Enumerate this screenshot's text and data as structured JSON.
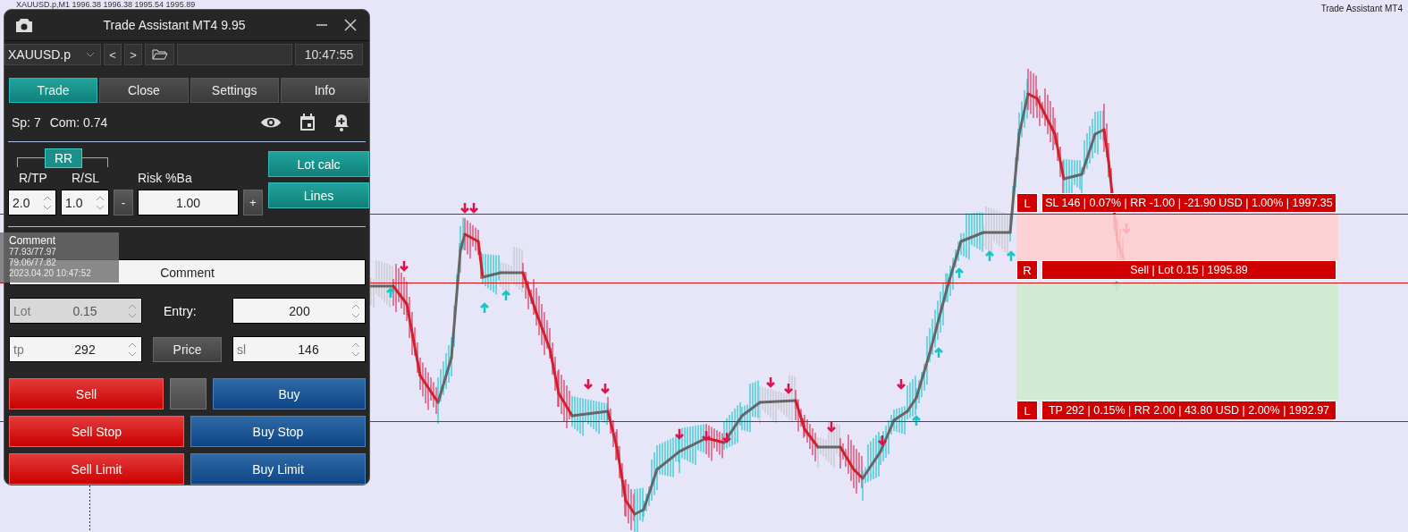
{
  "chart_header": "XAUUSD.p,M1  1996.38 1996.38 1995.54 1995.89",
  "indicator_label": "Trade Assistant MT4",
  "panel": {
    "title": "Trade Assistant MT4 9.95",
    "symbol": "XAUUSD.p",
    "time": "10:47:55",
    "prev": "<",
    "next": ">",
    "tabs": [
      {
        "label": "Trade",
        "selected": true
      },
      {
        "label": "Close",
        "selected": false
      },
      {
        "label": "Settings",
        "selected": false
      },
      {
        "label": "Info",
        "selected": false
      }
    ],
    "spread": "Sp: 7",
    "commission": "Com: 0.74",
    "rr_label": "RR",
    "rtp_label": "R/TP",
    "rsl_label": "R/SL",
    "risk_label": "Risk %Ba",
    "rtp_value": "2.0",
    "rsl_value": "1.0",
    "minus": "-",
    "risk_value": "1.00",
    "plus": "+",
    "lot_calc": "Lot calc",
    "lines": "Lines",
    "comment": "Comment",
    "lot": {
      "label": "Lot",
      "value": "0.15",
      "disabled": true
    },
    "entry_label": "Entry:",
    "entry_value": "200",
    "tp": {
      "label": "tp",
      "value": "292"
    },
    "price_button": "Price",
    "sl": {
      "label": "sl",
      "value": "146"
    },
    "orders": [
      {
        "label": "Sell",
        "kind": "sell"
      },
      {
        "label": "Buy",
        "kind": "buy"
      },
      {
        "label": "Sell Stop",
        "kind": "sell"
      },
      {
        "label": "Buy Stop",
        "kind": "buy"
      },
      {
        "label": "Sell Limit",
        "kind": "sell"
      },
      {
        "label": "Buy Limit",
        "kind": "buy"
      }
    ]
  },
  "tooltip": {
    "title": "Comment",
    "lines": [
      "77.93/77.97",
      "79.06/77.82",
      "2023.04.20 10:47:52"
    ]
  },
  "levels": [
    {
      "tag": "L",
      "text": "SL 146 | 0.07% | RR -1.00 | -21.90 USD | 1.00% | 1997.35",
      "kind": "sl"
    },
    {
      "tag": "R",
      "text": "Sell | Lot 0.15 | 1995.89",
      "kind": "entry"
    },
    {
      "tag": "L",
      "text": "TP 292 | 0.15% | RR 2.00 | 43.80 USD | 2.00% | 1992.97",
      "kind": "tp"
    }
  ]
}
